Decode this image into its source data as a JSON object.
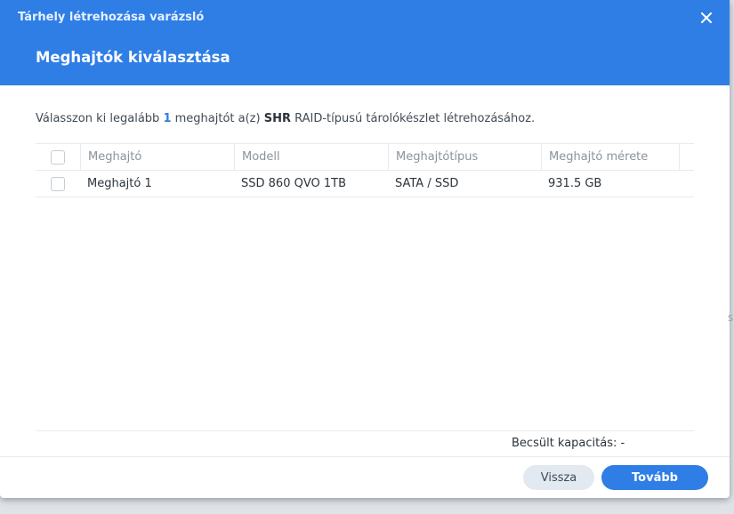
{
  "window": {
    "title": "Tárhely létrehozása varázsló",
    "close_icon": "close-icon",
    "header_color": "#2f7ee6"
  },
  "step": {
    "title": "Meghajtók kiválasztása"
  },
  "instruction": {
    "part1": "Válasszon ki legalább ",
    "min_count": "1",
    "part2": " meghajtót a(z) ",
    "raid_type": "SHR",
    "part3": " RAID-típusú tárolókészlet létrehozásához."
  },
  "table": {
    "columns": [
      "Meghajtó",
      "Modell",
      "Meghajtótípus",
      "Meghajtó mérete"
    ],
    "rows": [
      {
        "checked": false,
        "name": "Meghajtó 1",
        "model": "SSD 860 QVO 1TB",
        "type": "SATA / SSD",
        "size": "931.5 GB"
      }
    ]
  },
  "capacity": {
    "label": "Becsült kapacitás: -"
  },
  "buttons": {
    "back": "Vissza",
    "next": "Tovább"
  },
  "edge_text": "s"
}
